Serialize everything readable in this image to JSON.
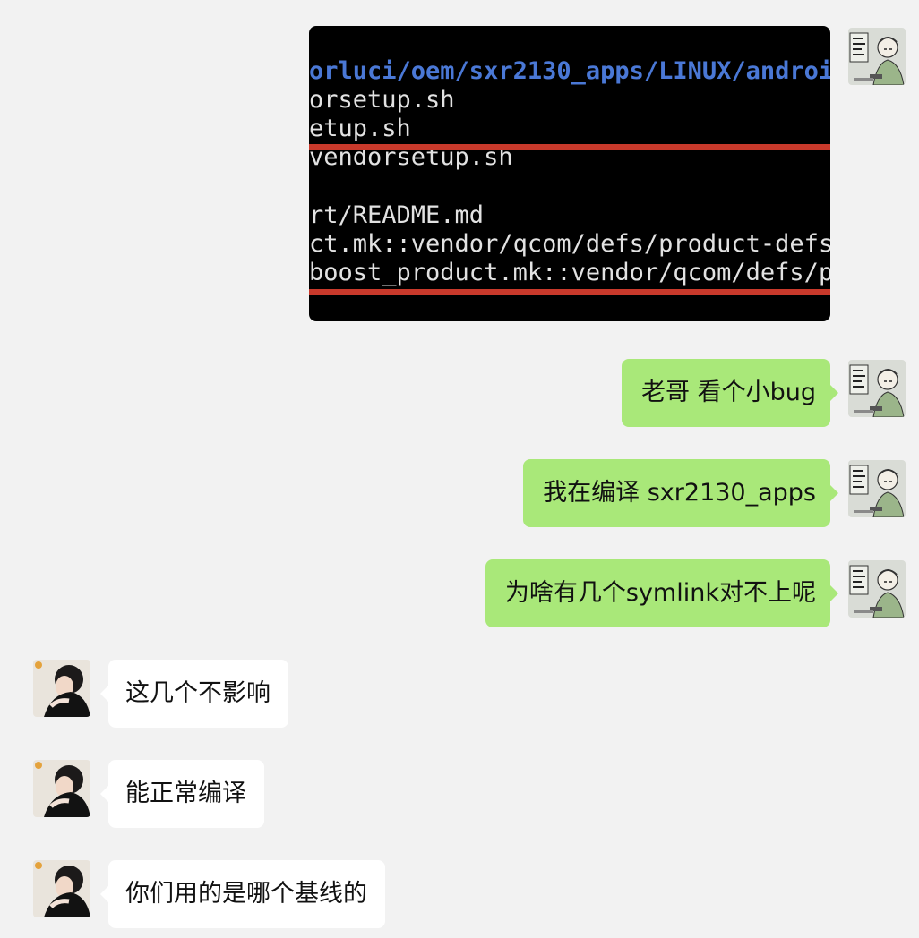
{
  "colors": {
    "page_bg": "#f2f2f2",
    "my_bubble": "#a9e879",
    "their_bubble": "#ffffff",
    "terminal_bg": "#000000",
    "terminal_path": "#4a78d6",
    "terminal_text": "#e2e2e2",
    "terminal_rule": "#c8392b"
  },
  "terminal_screenshot": {
    "lines": [
      "orluci/oem/sxr2130_apps/LINUX/androi",
      "orsetup.sh",
      "etup.sh",
      "vendorsetup.sh",
      "rt/README.md",
      "ct.mk::vendor/qcom/defs/product-defs",
      "boost_product.mk::vendor/qcom/defs/p"
    ]
  },
  "messages": [
    {
      "sender": "me",
      "text": "老哥 看个小bug"
    },
    {
      "sender": "me",
      "text": "我在编译 sxr2130_apps"
    },
    {
      "sender": "me",
      "text": "为啥有几个symlink对不上呢"
    },
    {
      "sender": "them",
      "text": "这几个不影响"
    },
    {
      "sender": "them",
      "text": "能正常编译"
    },
    {
      "sender": "them",
      "text": "你们用的是哪个基线的"
    }
  ],
  "avatars": {
    "me": "cartoon-avatar-icon",
    "them": "photo-avatar-icon"
  }
}
